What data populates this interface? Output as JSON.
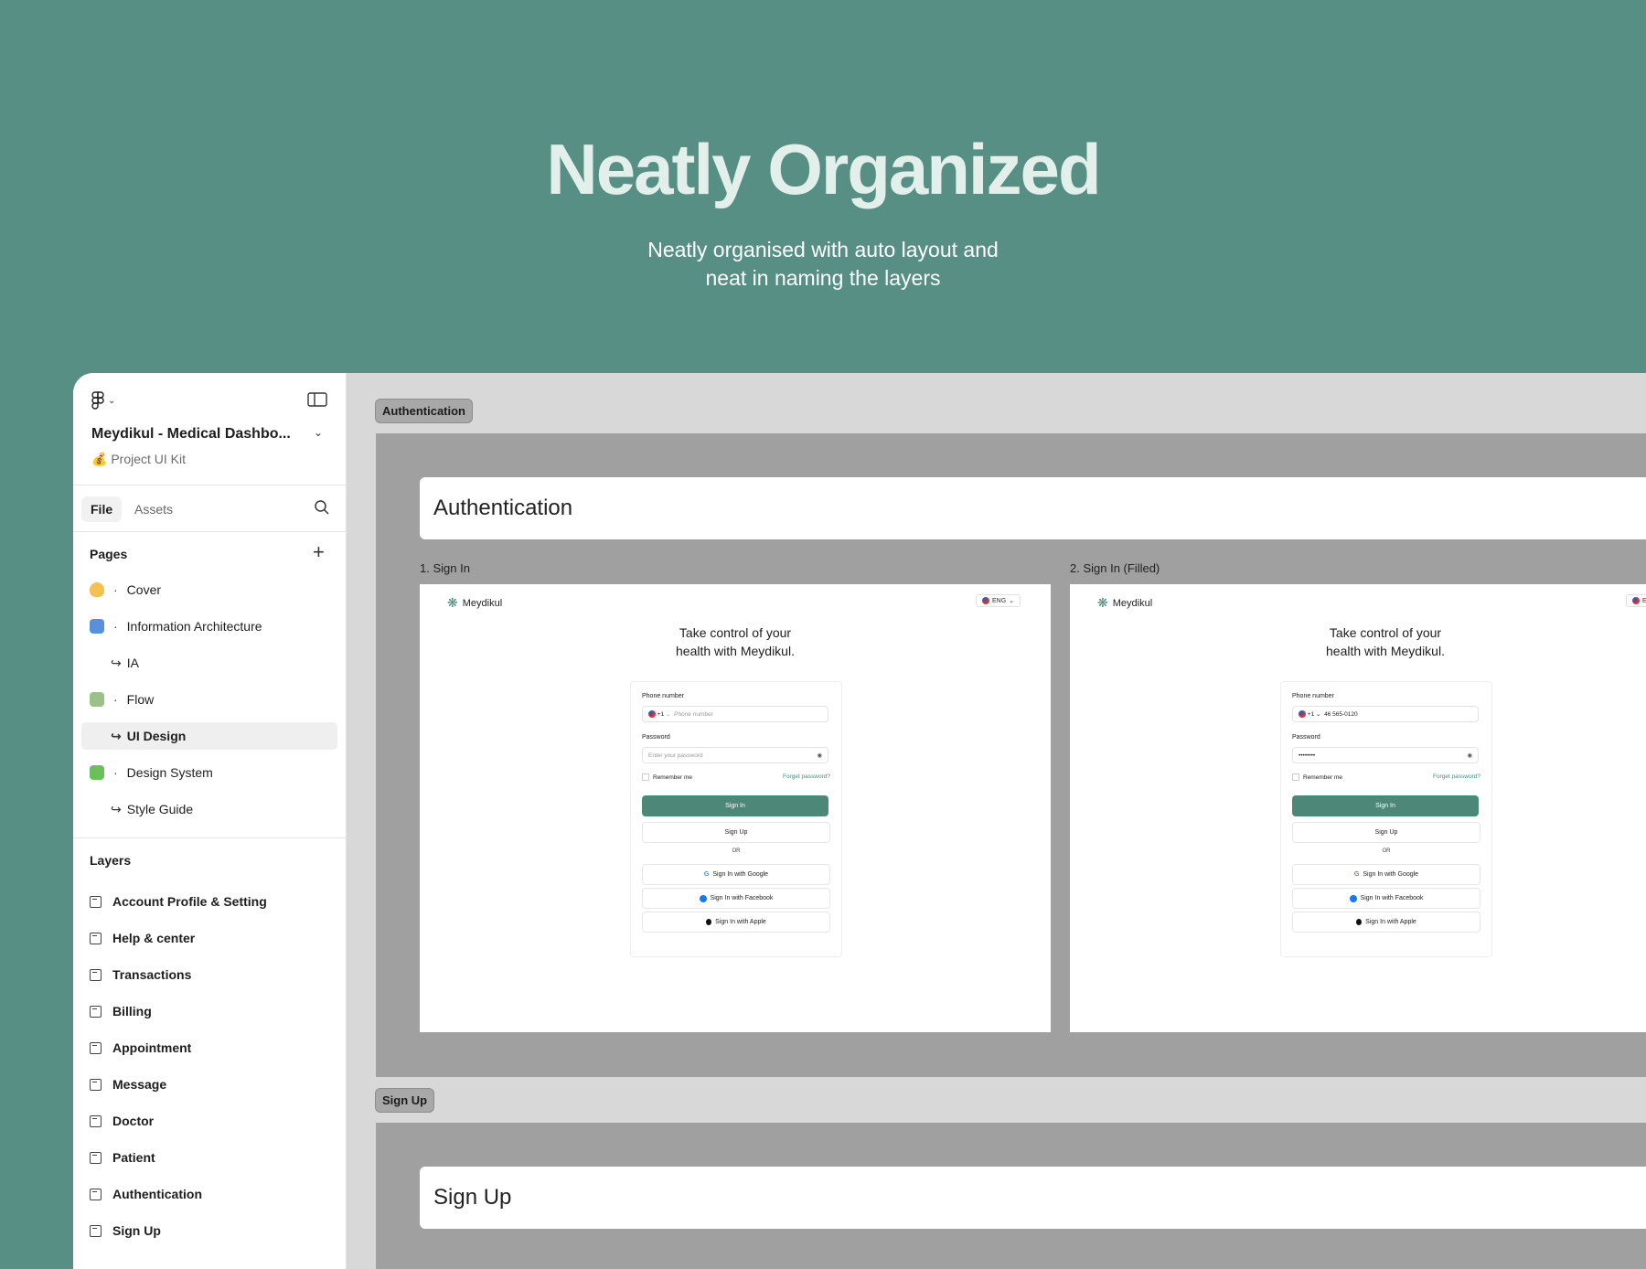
{
  "hero": {
    "title": "Neatly Organized",
    "subtitle_line1": "Neatly organised with auto layout and",
    "subtitle_line2": "neat in naming the layers"
  },
  "sidebar": {
    "project_name": "Meydikul - Medical Dashbo...",
    "project_subtitle": "Project UI Kit",
    "tabs": {
      "file": "File",
      "assets": "Assets"
    },
    "pages_title": "Pages",
    "pages": [
      {
        "label": "Cover",
        "icon": "waving-hand-icon",
        "type": "page"
      },
      {
        "label": "Information Architecture",
        "icon": "down-arrow-box-icon",
        "type": "page"
      },
      {
        "label": "IA",
        "type": "sub"
      },
      {
        "label": "Flow",
        "icon": "money-icon",
        "type": "page"
      },
      {
        "label": "UI Design",
        "type": "sub",
        "active": true
      },
      {
        "label": "Design System",
        "icon": "puzzle-icon",
        "type": "page"
      },
      {
        "label": "Style Guide",
        "type": "sub"
      }
    ],
    "layers_title": "Layers",
    "layers": [
      "Account Profile & Setting",
      "Help & center",
      "Transactions",
      "Billing",
      "Appointment",
      "Message",
      "Doctor",
      "Patient",
      "Authentication",
      "Sign Up"
    ]
  },
  "canvas": {
    "auth_tag": "Authentication",
    "auth_header": "Authentication",
    "signup_tag": "Sign Up",
    "signup_header": "Sign Up",
    "frames": [
      {
        "label": "1. Sign In",
        "brand": "Meydikul",
        "lang": "ENG",
        "headline_line1": "Take control of your",
        "headline_line2": "health with Meydikul.",
        "phone_label": "Phone number",
        "phone_code": "+1",
        "phone_value": "Phone number",
        "password_label": "Password",
        "password_value": "Enter your password",
        "remember": "Remember me",
        "forgot": "Forget password?",
        "sign_in": "Sign In",
        "sign_up": "Sign Up",
        "or": "OR",
        "google": "Sign In with Google",
        "facebook": "Sign In with Facebook",
        "apple": "Sign In with Apple"
      },
      {
        "label": "2. Sign In (Filled)",
        "brand": "Meydikul",
        "lang": "E",
        "headline_line1": "Take control of your",
        "headline_line2": "health with Meydikul.",
        "phone_label": "Phone number",
        "phone_code": "+1",
        "phone_value": "46 565-0120",
        "password_label": "Password",
        "password_value": "••••••••",
        "remember": "Remember me",
        "forgot": "Forget password?",
        "sign_in": "Sign In",
        "sign_up": "Sign Up",
        "or": "OR",
        "google": "Sign In with Google",
        "facebook": "Sign In with Facebook",
        "apple": "Sign In with Apple"
      }
    ]
  },
  "colors": {
    "background": "#578f85",
    "hero_title": "#e2efea",
    "primary_button": "#4c8778"
  }
}
